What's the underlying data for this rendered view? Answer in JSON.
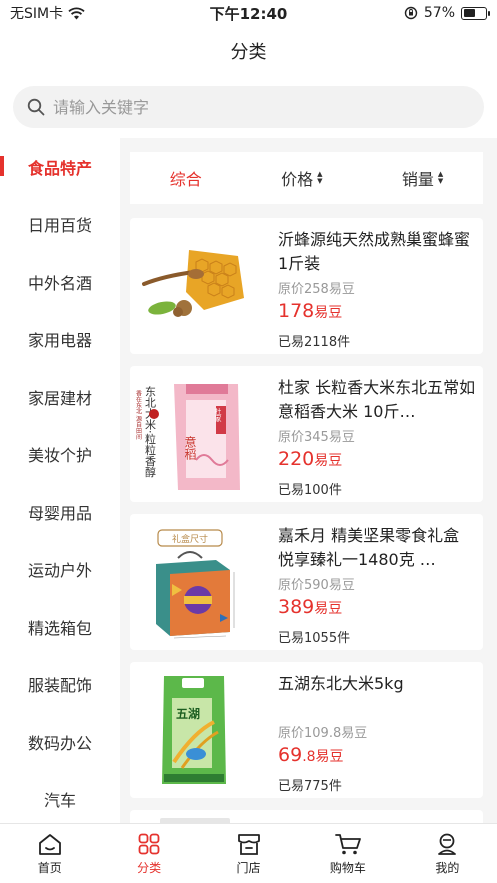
{
  "status": {
    "carrier": "无SIM卡",
    "time": "下午12:40",
    "battery": "57%",
    "battery_level": 0.57
  },
  "nav": {
    "title": "分类"
  },
  "search": {
    "placeholder": "请输入关键字"
  },
  "sidebar": {
    "items": [
      {
        "label": "食品特产"
      },
      {
        "label": "日用百货"
      },
      {
        "label": "中外名酒"
      },
      {
        "label": "家用电器"
      },
      {
        "label": "家居建材"
      },
      {
        "label": "美妆个护"
      },
      {
        "label": "母婴用品"
      },
      {
        "label": "运动户外"
      },
      {
        "label": "精选箱包"
      },
      {
        "label": "服装配饰"
      },
      {
        "label": "数码办公"
      },
      {
        "label": "汽车"
      }
    ]
  },
  "sort": {
    "tabs": [
      {
        "label": "综合"
      },
      {
        "label": "价格"
      },
      {
        "label": "销量"
      }
    ]
  },
  "products": [
    {
      "title": "沂蜂源纯天然成熟巢蜜蜂蜜 1斤装",
      "original": "原价258易豆",
      "price": "178",
      "price_unit": "易豆",
      "sold": "已易2118件"
    },
    {
      "title": "杜家 长粒香大米东北五常如意稻香大米 10斤…",
      "original": "原价345易豆",
      "price": "220",
      "price_unit": "易豆",
      "sold": "已易100件",
      "img_text": {
        "vertical_1": "东北大米·粒粒香醇",
        "vertical_2": "香在东北 源自田间",
        "bag_1": "意稻",
        "bag_2": "杜家"
      }
    },
    {
      "title": "嘉禾月 精美坚果零食礼盒 悦享臻礼一1480克 …",
      "original": "原价590易豆",
      "price": "389",
      "price_unit": "易豆",
      "sold": "已易1055件",
      "img_text": {
        "badge": "礼盒尺寸"
      }
    },
    {
      "title": "五湖东北大米5kg",
      "original": "原价109.8易豆",
      "price": "69",
      "price_decimal": ".8",
      "price_unit": "易豆",
      "sold": "已易775件",
      "img_text": {
        "bag": "五湖"
      }
    }
  ],
  "tabbar": {
    "items": [
      {
        "label": "首页"
      },
      {
        "label": "分类"
      },
      {
        "label": "门店"
      },
      {
        "label": "购物车"
      },
      {
        "label": "我的"
      }
    ]
  },
  "colors": {
    "accent": "#e5322d"
  }
}
